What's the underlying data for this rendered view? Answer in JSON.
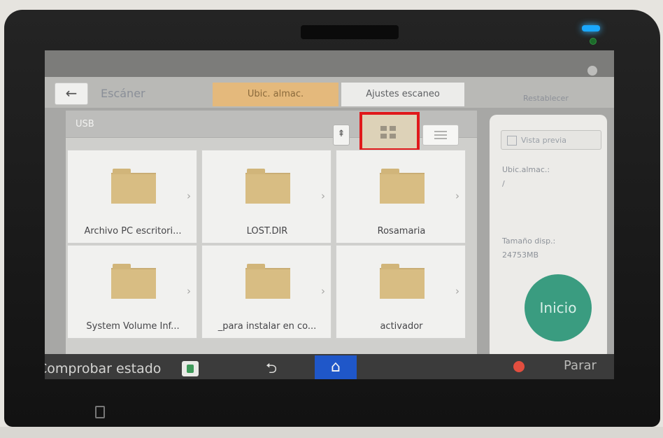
{
  "header": {
    "back_glyph": "←",
    "title": "Escáner",
    "reset_label": "Restablecer",
    "tabs": [
      {
        "label": "Ubic. almac."
      },
      {
        "label": "Ajustes escaneo"
      }
    ]
  },
  "browser": {
    "path": "USB",
    "up_glyph": "⇞",
    "view_mode_selected": "grid",
    "folders": [
      {
        "name": "Archivo PC escritori..."
      },
      {
        "name": "LOST.DIR"
      },
      {
        "name": "Rosamaria"
      },
      {
        "name": "System Volume Inf..."
      },
      {
        "name": "_para instalar en co..."
      },
      {
        "name": "activador"
      }
    ],
    "chevron": "›"
  },
  "side_panel": {
    "preview_label": "Vista previa",
    "location_label": "Ubic.almac.:",
    "location_value": "/",
    "size_label": "Tamaño disp.:",
    "size_value": "24753MB",
    "start_label": "Inicio"
  },
  "system_bar": {
    "status_label": "Comprobar estado",
    "undo_glyph": "⮌",
    "home_glyph": "⌂",
    "stop_label": "Parar"
  },
  "colors": {
    "accent_tab": "#e4b97c",
    "start_button": "#3a9c80",
    "home_button": "#1f57c9",
    "highlight_box": "#e0191b"
  }
}
